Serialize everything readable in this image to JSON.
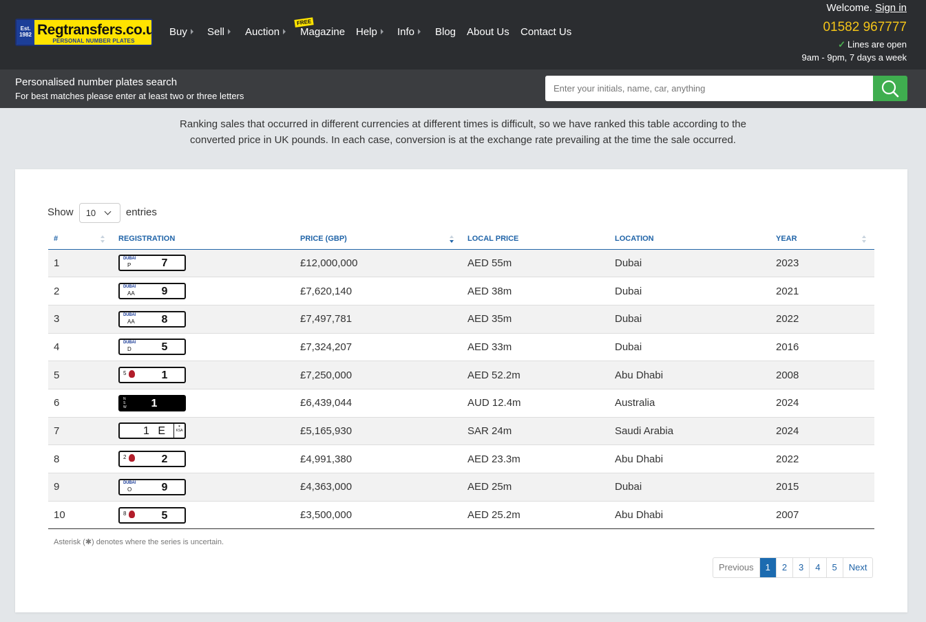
{
  "header": {
    "logo": {
      "est": "Est. 1982",
      "name": "Regtransfers.co.uk",
      "tagline": "PERSONAL NUMBER PLATES"
    },
    "nav": [
      {
        "label": "Buy",
        "caret": true
      },
      {
        "label": "Sell",
        "caret": true
      },
      {
        "label": "Auction",
        "caret": true
      },
      {
        "label": "Magazine",
        "caret": false
      },
      {
        "label": "Help",
        "caret": true
      },
      {
        "label": "Info",
        "caret": true
      },
      {
        "label": "Blog",
        "caret": false
      },
      {
        "label": "About Us",
        "caret": false
      },
      {
        "label": "Contact Us",
        "caret": false
      }
    ],
    "free_badge": "FREE",
    "welcome": "Welcome.",
    "sign_in": "Sign in",
    "phone": "01582 967777",
    "lines_open": "Lines are open",
    "hours": "9am - 9pm, 7 days a week"
  },
  "search": {
    "title": "Personalised number plates search",
    "subtitle": "For best matches please enter at least two or three letters",
    "placeholder": "Enter your initials, name, car, anything",
    "value": ""
  },
  "intro": "Ranking sales that occurred in different currencies at different times is difficult, so we have ranked this table according to the converted price in UK pounds. In each case, conversion is at the exchange rate prevailing at the time the sale occurred.",
  "table": {
    "show": "Show",
    "entries_value": "10",
    "entries": "entries",
    "columns": [
      "#",
      "REGISTRATION",
      "PRICE (GBP)",
      "LOCAL PRICE",
      "LOCATION",
      "YEAR"
    ],
    "rows": [
      {
        "rank": "1",
        "plate": {
          "style": "dubai",
          "emirate": "DUBAI",
          "series": "P",
          "number": "7"
        },
        "price_gbp": "£12,000,000",
        "local_price": "AED 55m",
        "location": "Dubai",
        "year": "2023"
      },
      {
        "rank": "2",
        "plate": {
          "style": "dubai",
          "emirate": "DUBAI",
          "series": "AA",
          "number": "9"
        },
        "price_gbp": "£7,620,140",
        "local_price": "AED 38m",
        "location": "Dubai",
        "year": "2021"
      },
      {
        "rank": "3",
        "plate": {
          "style": "dubai",
          "emirate": "DUBAI",
          "series": "AA",
          "number": "8"
        },
        "price_gbp": "£7,497,781",
        "local_price": "AED 35m",
        "location": "Dubai",
        "year": "2022"
      },
      {
        "rank": "4",
        "plate": {
          "style": "dubai",
          "emirate": "DUBAI",
          "series": "D",
          "number": "5"
        },
        "price_gbp": "£7,324,207",
        "local_price": "AED 33m",
        "location": "Dubai",
        "year": "2016"
      },
      {
        "rank": "5",
        "plate": {
          "style": "abudhabi",
          "series": "5",
          "number": "1"
        },
        "price_gbp": "£7,250,000",
        "local_price": "AED 52.2m",
        "location": "Abu Dhabi",
        "year": "2008"
      },
      {
        "rank": "6",
        "plate": {
          "style": "nsw",
          "number": "1"
        },
        "price_gbp": "£6,439,044",
        "local_price": "AUD 12.4m",
        "location": "Australia",
        "year": "2024"
      },
      {
        "rank": "7",
        "plate": {
          "style": "ksa",
          "number": "1 E"
        },
        "price_gbp": "£5,165,930",
        "local_price": "SAR 24m",
        "location": "Saudi Arabia",
        "year": "2024"
      },
      {
        "rank": "8",
        "plate": {
          "style": "abudhabi",
          "series": "2",
          "number": "2"
        },
        "price_gbp": "£4,991,380",
        "local_price": "AED 23.3m",
        "location": "Abu Dhabi",
        "year": "2022"
      },
      {
        "rank": "9",
        "plate": {
          "style": "dubai",
          "emirate": "DUBAI",
          "series": "O",
          "number": "9"
        },
        "price_gbp": "£4,363,000",
        "local_price": "AED 25m",
        "location": "Dubai",
        "year": "2015"
      },
      {
        "rank": "10",
        "plate": {
          "style": "abudhabi",
          "series": "8",
          "number": "5"
        },
        "price_gbp": "£3,500,000",
        "local_price": "AED 25.2m",
        "location": "Abu Dhabi",
        "year": "2007"
      }
    ],
    "asterisk_note": "Asterisk (✱) denotes where the series is uncertain."
  },
  "pagination": {
    "previous": "Previous",
    "pages": [
      "1",
      "2",
      "3",
      "4",
      "5"
    ],
    "active": "1",
    "next": "Next"
  },
  "colors": {
    "header_bg": "#2b2d30",
    "accent_yellow": "#f5c518",
    "search_button": "#3fae4f",
    "link_blue": "#2064a8"
  }
}
